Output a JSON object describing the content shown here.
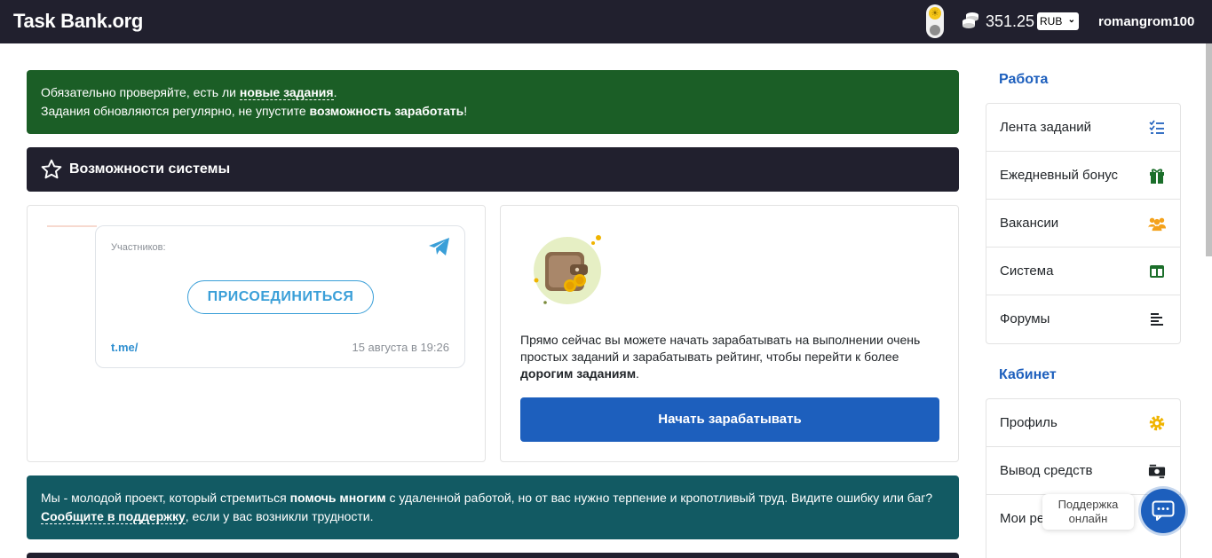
{
  "header": {
    "logo": "Task Bank.org",
    "balance": "351.25",
    "currency": "RUB",
    "username": "romangrom100"
  },
  "notice": {
    "line1_prefix": "Обязательно проверяйте, есть ли ",
    "line1_link": "новые задания",
    "line1_suffix": ".",
    "line2_prefix": "Задания обновляются регулярно, не упустите ",
    "line2_bold": "возможность заработать",
    "line2_suffix": "!"
  },
  "features_panel": {
    "title": "Возможности системы"
  },
  "telegram": {
    "members_label": "Участников:",
    "join_button": "ПРИСОЕДИНИТЬСЯ",
    "link": "t.me/",
    "date": "15 августа в 19:26"
  },
  "earn": {
    "text_prefix": "Прямо сейчас вы можете начать зарабатывать на выполнении очень простых заданий и зарабатывать рейтинг, чтобы перейти к более ",
    "text_bold": "дорогим заданиям",
    "text_suffix": ".",
    "button": "Начать зарабатывать"
  },
  "info": {
    "p1": "Мы - молодой проект, который стремиться ",
    "b1": "помочь многим",
    "p2": " с удаленной работой, но от вас нужно терпение и кропотливый труд. Видите ошибку или баг? ",
    "link": "Сообщите в поддержку",
    "p3": ", если у вас возникли трудности."
  },
  "sidebar": {
    "work_title": "Работа",
    "work_items": [
      {
        "label": "Лента заданий",
        "icon": "tasks-list-icon"
      },
      {
        "label": "Ежедневный бонус",
        "icon": "gift-icon"
      },
      {
        "label": "Вакансии",
        "icon": "users-icon"
      },
      {
        "label": "Система",
        "icon": "layout-icon"
      },
      {
        "label": "Форумы",
        "icon": "align-left-icon"
      }
    ],
    "cabinet_title": "Кабинет",
    "cabinet_items": [
      {
        "label": "Профиль",
        "icon": "gear-icon"
      },
      {
        "label": "Вывод средств",
        "icon": "money-icon"
      },
      {
        "label": "Мои ре",
        "icon": ""
      }
    ]
  },
  "support": {
    "line1": "Поддержка",
    "line2": "онлайн"
  },
  "colors": {
    "topbar": "#21202e",
    "notice_green": "#1b5e26",
    "info_teal": "#125a63",
    "primary_blue": "#1d5fbd",
    "telegram_blue": "#3a9fd8"
  }
}
